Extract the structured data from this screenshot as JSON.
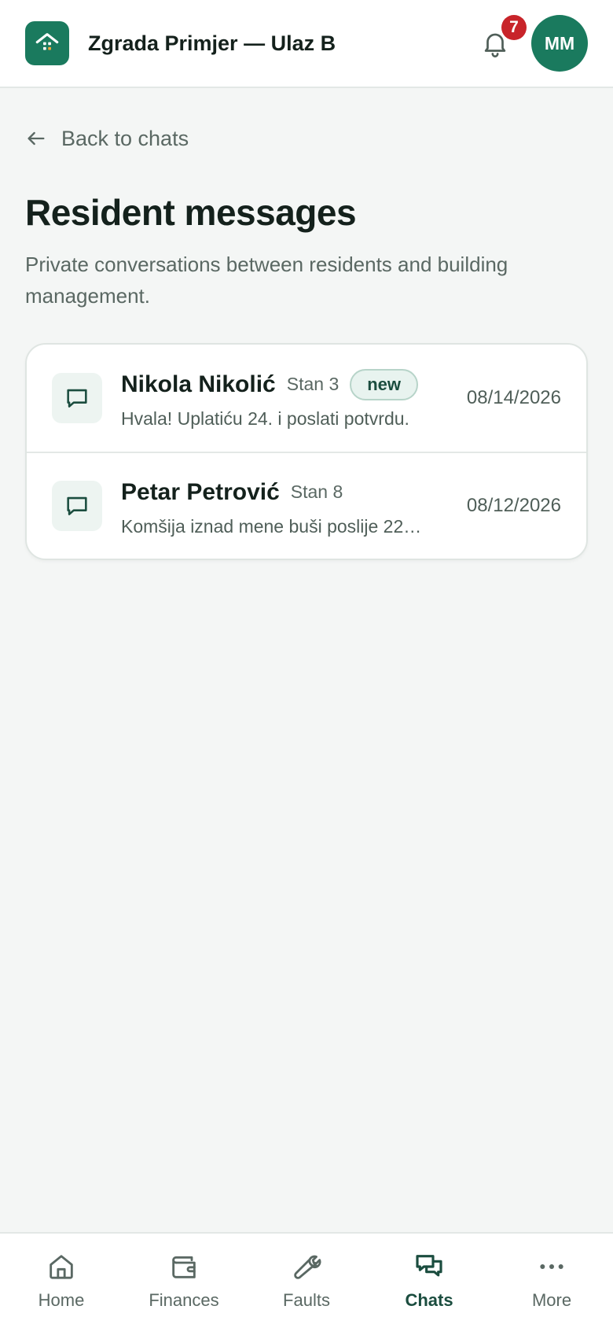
{
  "header": {
    "title": "Zgrada Primjer — Ulaz B",
    "notification_count": "7",
    "avatar_initials": "MM"
  },
  "back_label": "Back to chats",
  "page": {
    "title": "Resident messages",
    "subtitle": "Private conversations between residents and building management."
  },
  "chats": [
    {
      "name": "Nikola Nikolić",
      "unit": "Stan 3",
      "badge": "new",
      "preview": "Hvala! Uplatiću 24. i poslati potvrdu.",
      "date": "08/14/2026"
    },
    {
      "name": "Petar Petrović",
      "unit": "Stan 8",
      "preview": "Komšija iznad mene buši poslije 22…",
      "date": "08/12/2026"
    }
  ],
  "nav": [
    {
      "label": "Home",
      "icon": "home-icon"
    },
    {
      "label": "Finances",
      "icon": "wallet-icon"
    },
    {
      "label": "Faults",
      "icon": "wrench-icon"
    },
    {
      "label": "Chats",
      "icon": "chats-icon",
      "active": true
    },
    {
      "label": "More",
      "icon": "more-icon"
    }
  ],
  "colors": {
    "brand": "#1a7a5e",
    "badge": "#c8242a",
    "background": "#f4f6f5",
    "active_nav": "#1b4d3f"
  }
}
